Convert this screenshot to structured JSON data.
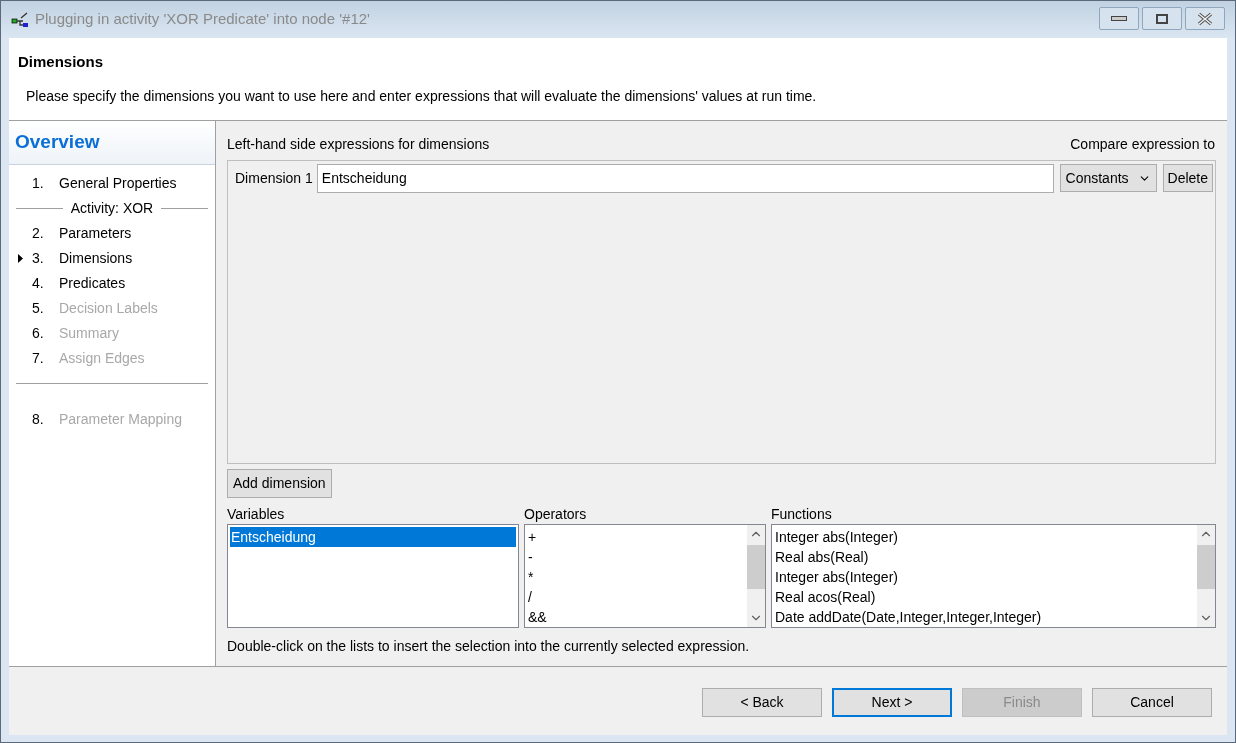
{
  "window": {
    "title": "Plugging in activity 'XOR Predicate' into node '#12'"
  },
  "header": {
    "title": "Dimensions",
    "description": "Please specify the dimensions you want to use here and enter expressions that will evaluate the dimensions' values at run time."
  },
  "sidebar": {
    "title": "Overview",
    "items": [
      {
        "kind": "step",
        "number": "1.",
        "label": "General Properties",
        "current": false,
        "disabled": false
      },
      {
        "kind": "separator",
        "label": "Activity: XOR"
      },
      {
        "kind": "step",
        "number": "2.",
        "label": "Parameters",
        "current": false,
        "disabled": false
      },
      {
        "kind": "step",
        "number": "3.",
        "label": "Dimensions",
        "current": true,
        "disabled": false
      },
      {
        "kind": "step",
        "number": "4.",
        "label": "Predicates",
        "current": false,
        "disabled": false
      },
      {
        "kind": "step",
        "number": "5.",
        "label": "Decision Labels",
        "current": false,
        "disabled": true
      },
      {
        "kind": "step",
        "number": "6.",
        "label": "Summary",
        "current": false,
        "disabled": true
      },
      {
        "kind": "step",
        "number": "7.",
        "label": "Assign Edges",
        "current": false,
        "disabled": true
      },
      {
        "kind": "separator"
      },
      {
        "kind": "step",
        "number": "8.",
        "label": "Parameter Mapping",
        "current": false,
        "disabled": true
      }
    ]
  },
  "dimensions": {
    "heading": "Left-hand side expressions for dimensions",
    "compare_heading": "Compare expression to",
    "rows": [
      {
        "label": "Dimension 1",
        "value": "Entscheidung",
        "compare": "Constants",
        "delete_label": "Delete"
      }
    ],
    "add_button": "Add dimension"
  },
  "lists": [
    {
      "title": "Variables",
      "scrollable": false,
      "items": [
        {
          "label": "Entscheidung",
          "selected": true
        }
      ]
    },
    {
      "title": "Operators",
      "scrollable": true,
      "items": [
        {
          "label": "+",
          "selected": false
        },
        {
          "label": "-",
          "selected": false
        },
        {
          "label": "*",
          "selected": false
        },
        {
          "label": "/",
          "selected": false
        },
        {
          "label": "&&",
          "selected": false
        }
      ]
    },
    {
      "title": "Functions",
      "scrollable": true,
      "items": [
        {
          "label": "Integer abs(Integer)",
          "selected": false
        },
        {
          "label": "Real abs(Real)",
          "selected": false
        },
        {
          "label": "Integer abs(Integer)",
          "selected": false
        },
        {
          "label": "Real acos(Real)",
          "selected": false
        },
        {
          "label": "Date addDate(Date,Integer,Integer,Integer)",
          "selected": false
        }
      ]
    }
  ],
  "hint": "Double-click on the lists to insert the selection into the currently selected expression.",
  "buttons": [
    {
      "label": "< Back",
      "default": false,
      "disabled": false
    },
    {
      "label": "Next >",
      "default": true,
      "disabled": false
    },
    {
      "label": "Finish",
      "default": false,
      "disabled": true
    },
    {
      "label": "Cancel",
      "default": false,
      "disabled": false
    }
  ]
}
